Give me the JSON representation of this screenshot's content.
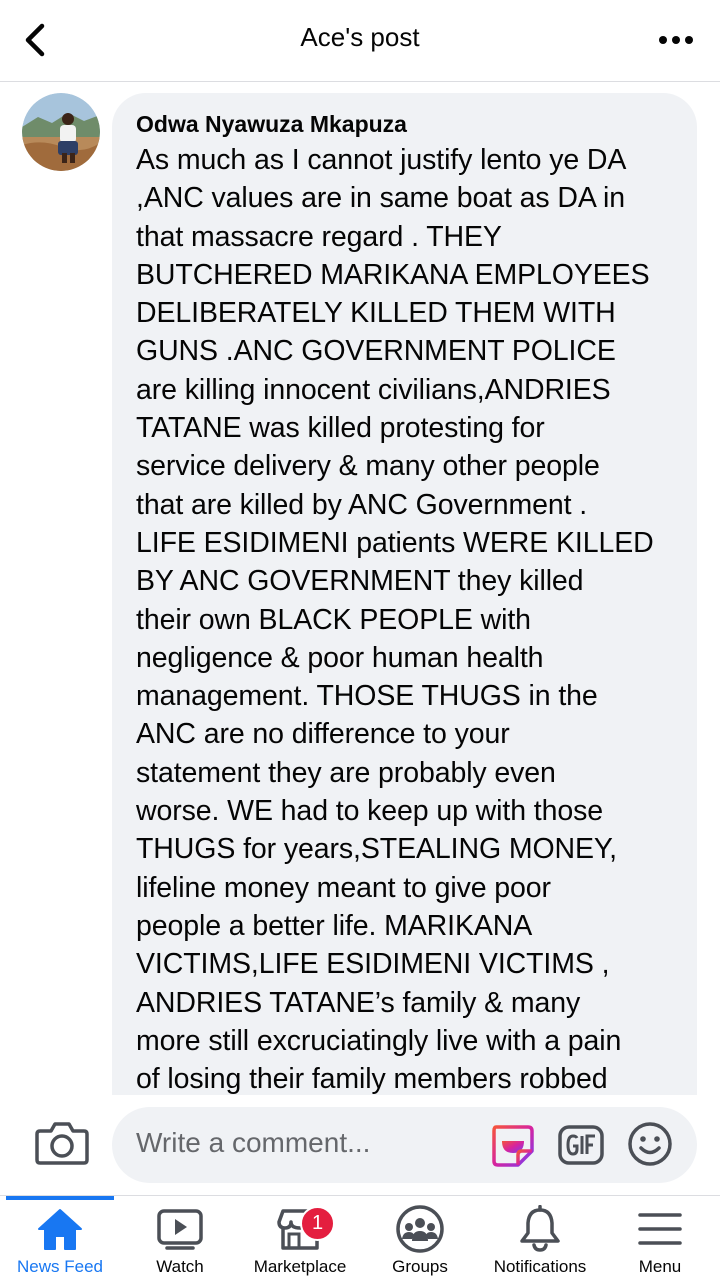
{
  "header": {
    "title": "Ace's post"
  },
  "comment": {
    "author": "Odwa Nyawuza Mkapuza",
    "text": "As much as I cannot justify lento ye DA\n,ANC values are in same boat as DA in\nthat massacre regard . THEY\nBUTCHERED MARIKANA EMPLOYEES\nDELIBERATELY KILLED THEM WITH\nGUNS .ANC GOVERNMENT POLICE\nare killing innocent civilians,ANDRIES\nTATANE was killed protesting for\nservice delivery & many other people\nthat are killed by ANC Government .\nLIFE ESIDIMENI patients WERE KILLED\nBY ANC GOVERNMENT they killed\ntheir own BLACK PEOPLE with\nnegligence & poor human health\nmanagement. THOSE THUGS in the\nANC are no difference to your\nstatement they are probably even\nworse. WE had to keep up with those\nTHUGS for years,STEALING MONEY,\nlifeline money meant to give poor\npeople a better life. MARIKANA\nVICTIMS,LIFE ESIDIMENI VICTIMS ,\nANDRIES TATANE’s family & many\nmore still excruciatingly live with a pain\nof losing their family members robbed"
  },
  "composer": {
    "placeholder": "Write a comment..."
  },
  "tabs": [
    {
      "label": "News Feed",
      "icon": "home-icon",
      "active": true
    },
    {
      "label": "Watch",
      "icon": "watch-icon",
      "active": false
    },
    {
      "label": "Marketplace",
      "icon": "marketplace-icon",
      "active": false,
      "badge": "1"
    },
    {
      "label": "Groups",
      "icon": "groups-icon",
      "active": false
    },
    {
      "label": "Notifications",
      "icon": "bell-icon",
      "active": false
    },
    {
      "label": "Menu",
      "icon": "hamburger-menu-icon",
      "active": false
    }
  ],
  "colors": {
    "accent": "#1877f2",
    "bubble": "#f0f2f5",
    "badge": "#e41e3f",
    "icon": "#4b4f56"
  }
}
